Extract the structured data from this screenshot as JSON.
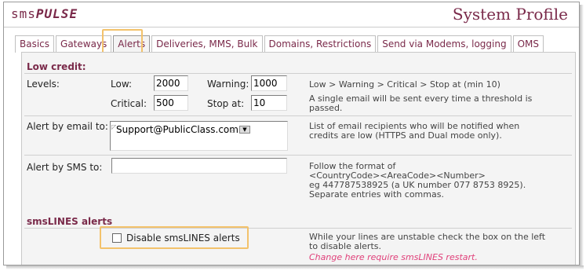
{
  "header": {
    "logo_prefix": "sms",
    "logo_brand": "PULSE",
    "title": "System Profile"
  },
  "tabs": [
    {
      "label": "Basics"
    },
    {
      "label": "Gateways"
    },
    {
      "label": "Alerts"
    },
    {
      "label": "Deliveries, MMS, Bulk"
    },
    {
      "label": "Domains, Restrictions"
    },
    {
      "label": "Send via Modems, logging"
    },
    {
      "label": "OMS"
    }
  ],
  "active_tab": "Alerts",
  "low_credit": {
    "heading": "Low credit:",
    "levels_label": "Levels:",
    "low_label": "Low:",
    "low_value": "2000",
    "warning_label": "Warning:",
    "warning_value": "1000",
    "critical_label": "Critical:",
    "critical_value": "500",
    "stop_label": "Stop at:",
    "stop_value": "10",
    "levels_note_1": "Low > Warning > Critical > Stop at (min 10)",
    "levels_note_2": "A single email will be sent every time a threshold is",
    "levels_note_3": "passed.",
    "email_label": "Alert by email to:",
    "email_value": "Support@PublicClass.com",
    "email_note_1": "List of email recipients who will be notified when",
    "email_note_2": "credits are low (HTTPS and Dual mode only).",
    "sms_label": "Alert by SMS to:",
    "sms_value": "",
    "sms_note_1": "Follow the format of",
    "sms_note_2": "<CountryCode><AreaCode><Number>",
    "sms_note_3": "eg 447787538925 (a UK number 077 8753 8925).",
    "sms_note_4": "Separate entries with commas."
  },
  "smslines": {
    "heading": "smsLINES alerts",
    "checkbox_label": "Disable smsLINES alerts",
    "checked": false,
    "note_1": "While your lines are unstable check the box on the left",
    "note_2": "to disable alerts.",
    "note_3": "Change here require smsLINES restart."
  },
  "colors": {
    "brand": "#7a2a4a",
    "panel_bg": "#f4f4f4",
    "highlight": "#f3c26b",
    "warning_text": "#e0407a"
  }
}
